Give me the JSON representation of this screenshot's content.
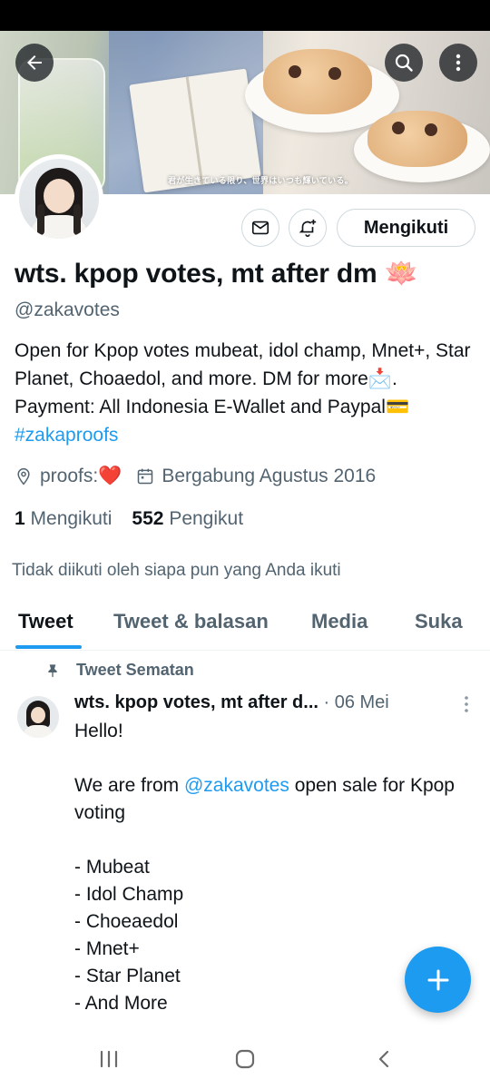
{
  "banner": {
    "caption": "君が生きている限り、世界はいつも輝いている。"
  },
  "toolbar": {
    "back_icon": "arrow-left-icon",
    "search_icon": "search-icon",
    "more_icon": "more-vertical-icon"
  },
  "actions": {
    "message_icon": "envelope-icon",
    "notify_icon": "bell-plus-icon",
    "follow_label": "Mengikuti"
  },
  "profile": {
    "name": "wts. kpop votes, mt after dm 🪷",
    "handle": "@zakavotes",
    "bio_text": "Open for Kpop votes mubeat, idol champ, Mnet+, Star Planet, Choaedol, and more. DM for more📩. Payment: All Indonesia E-Wallet and Paypal💳 ",
    "bio_link": "#zakaproofs",
    "location": "proofs:❤️",
    "joined": "Bergabung Agustus 2016",
    "following_count": "1",
    "following_label": "Mengikuti",
    "followers_count": "552",
    "followers_label": "Pengikut",
    "not_followed_note": "Tidak diikuti oleh siapa pun yang Anda ikuti"
  },
  "tabs": [
    {
      "label": "Tweet",
      "active": true
    },
    {
      "label": "Tweet & balasan",
      "active": false
    },
    {
      "label": "Media",
      "active": false
    },
    {
      "label": "Suka",
      "active": false
    }
  ],
  "pinned_tweet": {
    "pinned_label": "Tweet Sematan",
    "author": "wts. kpop votes, mt after d...",
    "date": "· 06 Mei",
    "line1": "Hello!",
    "line2_pre": "We are from ",
    "line2_mention": "@zakavotes",
    "line2_post": " open sale for Kpop voting",
    "items": [
      "- Mubeat",
      "- Idol Champ",
      "- Choeaedol",
      "- Mnet+",
      "- Star Planet",
      "- And More"
    ]
  },
  "colors": {
    "accent": "#1d9bf0",
    "text": "#0f1419",
    "secondary": "#536471"
  }
}
